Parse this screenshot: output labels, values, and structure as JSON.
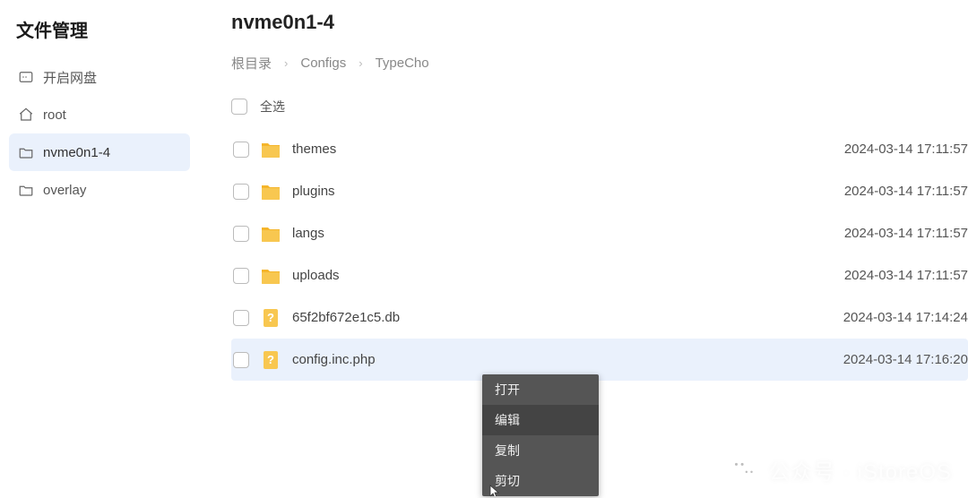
{
  "sidebar": {
    "title": "文件管理",
    "items": [
      {
        "label": "开启网盘",
        "icon": "disk-icon",
        "active": false
      },
      {
        "label": "root",
        "icon": "home-icon",
        "active": false
      },
      {
        "label": "nvme0n1-4",
        "icon": "folder-open-icon",
        "active": true
      },
      {
        "label": "overlay",
        "icon": "folder-open-icon",
        "active": false
      }
    ]
  },
  "header": {
    "title": "nvme0n1-4",
    "breadcrumb": [
      "根目录",
      "Configs",
      "TypeCho"
    ]
  },
  "select_all": {
    "label": "全选"
  },
  "files": [
    {
      "name": "themes",
      "type": "folder",
      "date": "2024-03-14 17:11:57",
      "selected": false
    },
    {
      "name": "plugins",
      "type": "folder",
      "date": "2024-03-14 17:11:57",
      "selected": false
    },
    {
      "name": "langs",
      "type": "folder",
      "date": "2024-03-14 17:11:57",
      "selected": false
    },
    {
      "name": "uploads",
      "type": "folder",
      "date": "2024-03-14 17:11:57",
      "selected": false
    },
    {
      "name": "65f2bf672e1c5.db",
      "type": "file",
      "date": "2024-03-14 17:14:24",
      "selected": false
    },
    {
      "name": "config.inc.php",
      "type": "file",
      "date": "2024-03-14 17:16:20",
      "selected": true
    }
  ],
  "context_menu": {
    "items": [
      "打开",
      "编辑",
      "复制",
      "剪切"
    ],
    "hover_index": 1
  },
  "watermark": {
    "text": "公众号 · iStoreOS"
  }
}
